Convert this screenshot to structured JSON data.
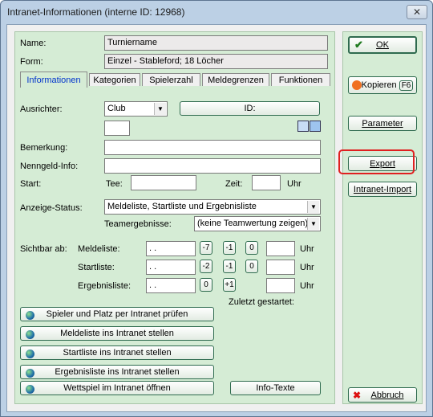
{
  "window": {
    "title": "Intranet-Informationen (interne ID: 12968)",
    "close": "✕"
  },
  "header": {
    "name_label": "Name:",
    "name_value": "Turniername",
    "form_label": "Form:",
    "form_value": "Einzel - Stableford; 18 Löcher"
  },
  "tabs": [
    "Informationen",
    "Kategorien",
    "Spielerzahl",
    "Meldegrenzen",
    "Funktionen"
  ],
  "info": {
    "ausrichter_label": "Ausrichter:",
    "ausrichter_value": "Club",
    "id_button": "ID:",
    "bemerkung_label": "Bemerkung:",
    "bemerkung_value": "",
    "nenngeld_label": "Nenngeld-Info:",
    "nenngeld_value": "",
    "start_label": "Start:",
    "tee_label": "Tee:",
    "tee_value": "",
    "zeit_label": "Zeit:",
    "zeit_value": "",
    "uhr": "Uhr",
    "anzeige_label": "Anzeige-Status:",
    "anzeige_value": "Meldeliste, Startliste und Ergebnisliste",
    "teamergebnisse_label": "Teamergebnisse:",
    "teamergebnisse_value": "(keine Teamwertung zeigen)",
    "sichtbar_label": "Sichtbar ab:",
    "meldeliste_label": "Meldeliste:",
    "meldeliste_date": " .  .",
    "meldeliste_btns": [
      "-7",
      "-1",
      "0"
    ],
    "startliste_label": "Startliste:",
    "startliste_date": " .  .",
    "startliste_btns": [
      "-2",
      "-1",
      "0"
    ],
    "ergebnisliste_label": "Ergebnisliste:",
    "ergebnisliste_date": " .  .",
    "ergebnisliste_btns": [
      "0",
      "+1"
    ],
    "zuletzt_label": "Zuletzt gestartet:"
  },
  "actions": [
    "Spieler und Platz per Intranet prüfen",
    "Meldeliste ins Intranet stellen",
    "Startliste ins Intranet stellen",
    "Ergebnisliste ins Intranet stellen",
    "Wettspiel im Intranet öffnen"
  ],
  "info_texte_button": "Info-Texte",
  "side": {
    "ok": "OK",
    "kopieren": "Kopieren",
    "kopieren_key": "F6",
    "parameter": "Parameter",
    "export": "Export",
    "intranet_import": "Intranet-Import",
    "abbruch": "Abbruch"
  }
}
